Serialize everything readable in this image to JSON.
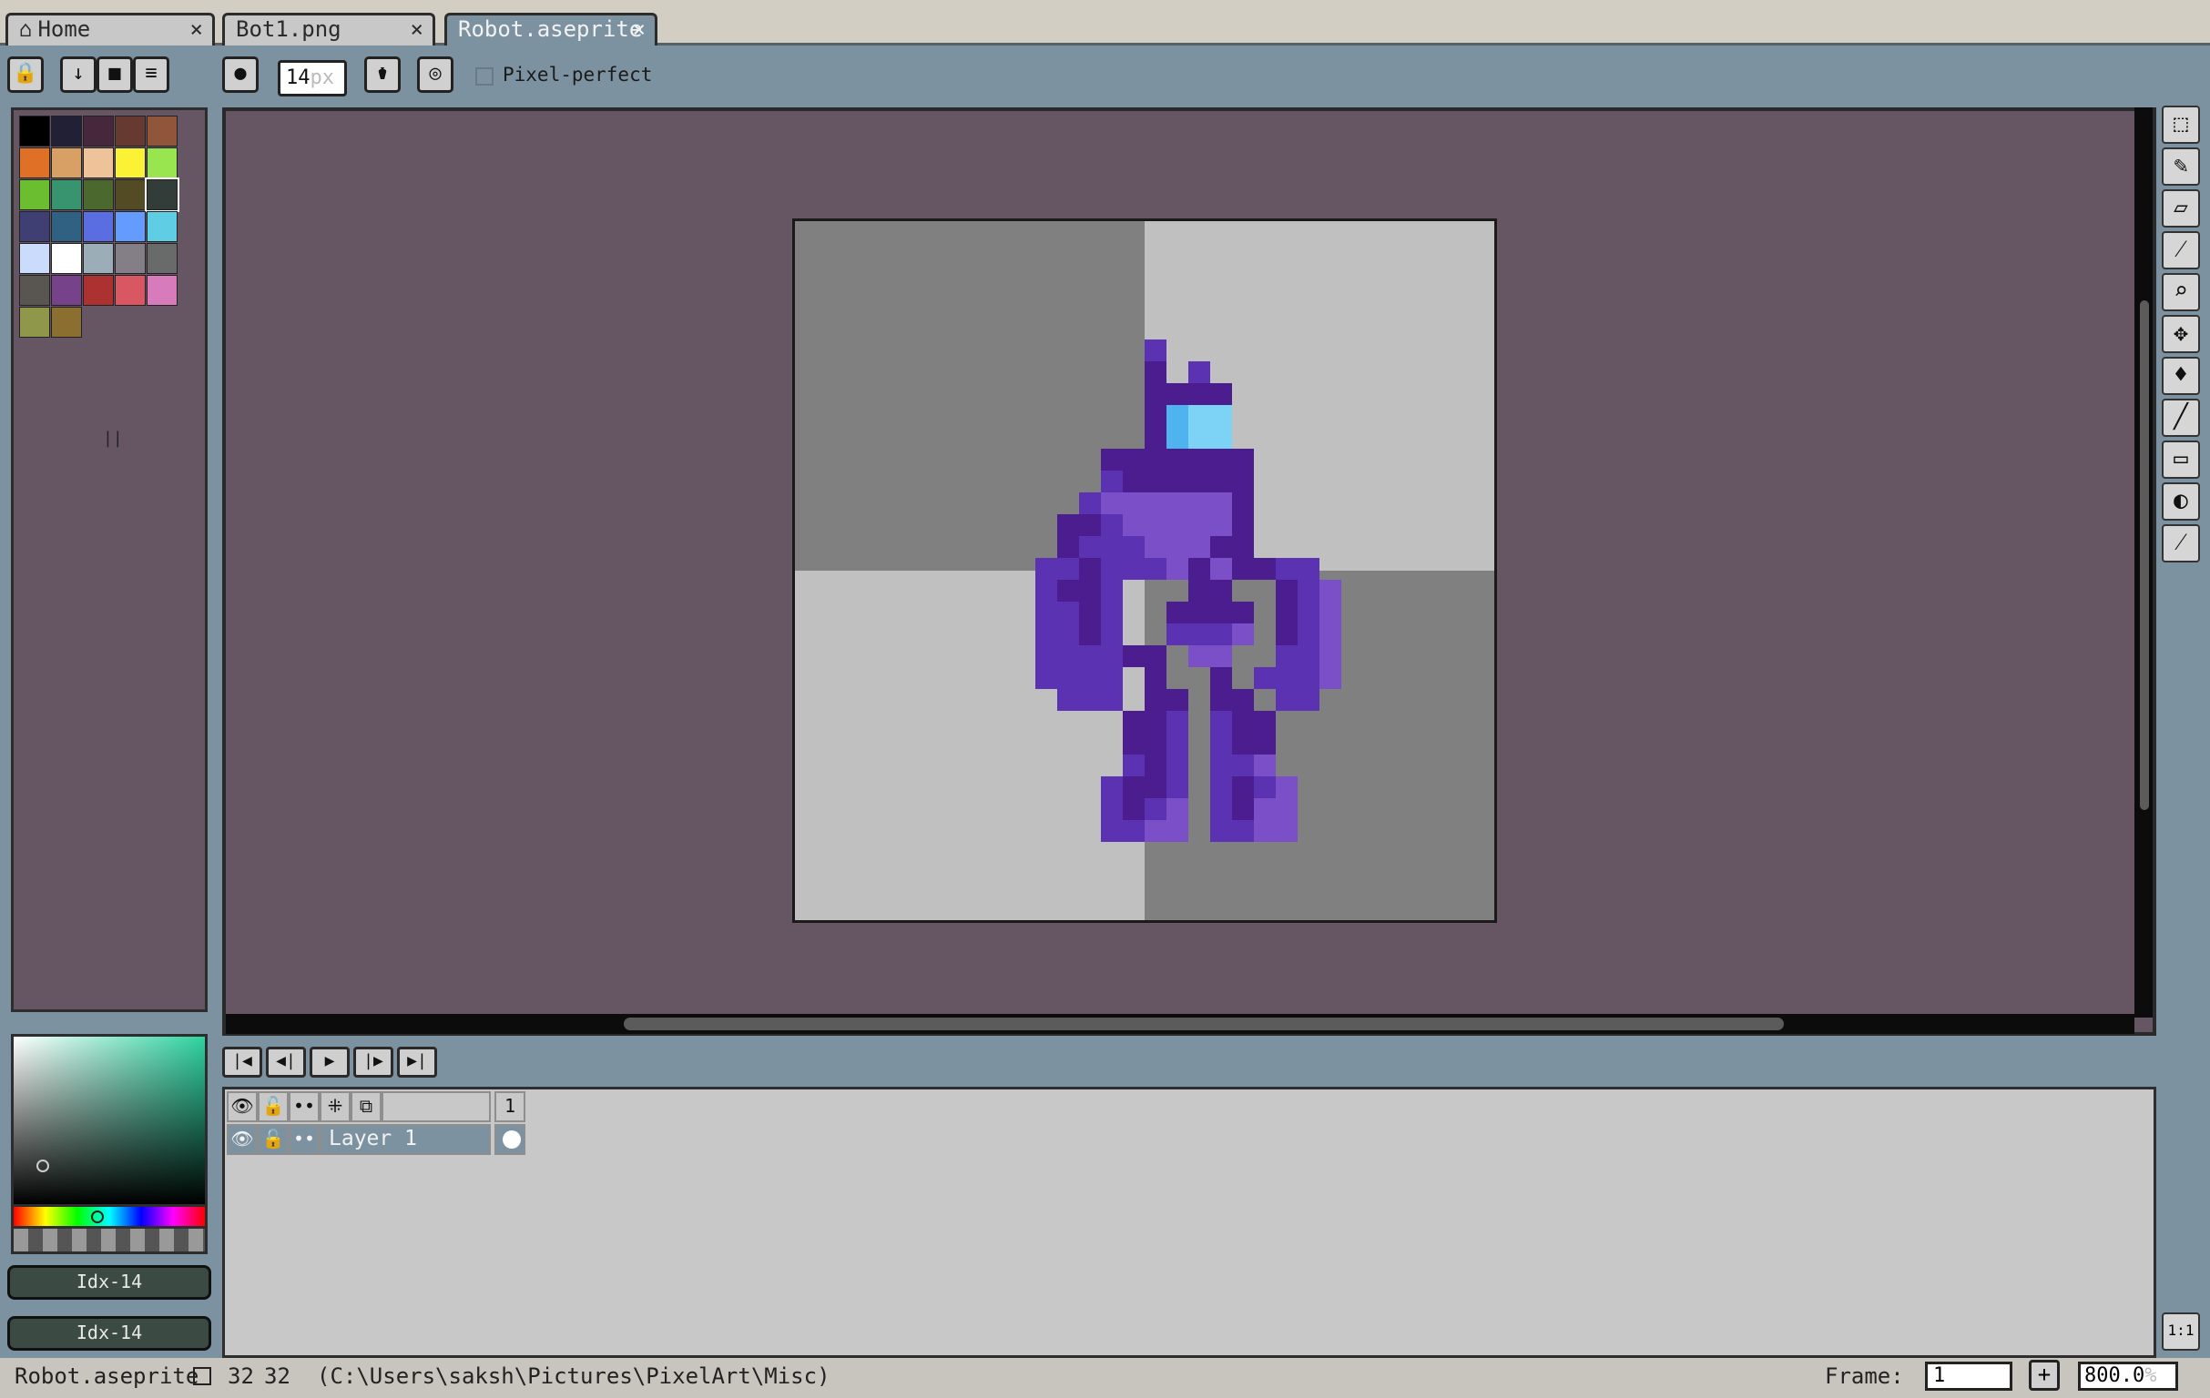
{
  "tabs": [
    {
      "label": "Home",
      "close": "×"
    },
    {
      "label": "Bot1.png",
      "close": "×"
    },
    {
      "label": "Robot.aseprite",
      "close": "×"
    }
  ],
  "toolbar": {
    "brush_size_value": "14",
    "brush_size_unit": "px",
    "pixel_perfect_label": "Pixel-perfect"
  },
  "palette": {
    "colors": [
      "#000000",
      "#222034",
      "#45283c",
      "#663931",
      "#8f563b",
      "#df7126",
      "#d9a066",
      "#eec39a",
      "#fbf236",
      "#99e550",
      "#6abe30",
      "#37946e",
      "#4b692f",
      "#524b24",
      "#323c39",
      "#3f3f74",
      "#306082",
      "#5b6ee1",
      "#639bff",
      "#5fcde4",
      "#cbdbfc",
      "#ffffff",
      "#9badb7",
      "#847e87",
      "#696a6a",
      "#595652",
      "#76428a",
      "#ac3232",
      "#d95763",
      "#d77bba",
      "#8f974a",
      "#8a6f30"
    ],
    "count_label": "||"
  },
  "color_selector": {
    "fg_label": "Idx-14",
    "bg_label": "Idx-14"
  },
  "sprite": {
    "checker_dark": "#808080",
    "checker_light": "#c0c0c0",
    "palette": {
      "1": "#4b1d8f",
      "2": "#5b32b2",
      "3": "#7a4fc8",
      "4": "#4fb3f0",
      "5": "#7dd3f5"
    },
    "rows": [
      "................",
      ".......2.......",
      ".......1.2......",
      ".......1111.....",
      ".......1455.....",
      ".......1455.....",
      ".....1111111....",
      ".....2111111....",
      "....23333331....",
      "...112333331....",
      "...122233311....",
      "..2212223131122.",
      "..2112...11..123",
      "..2212..1111.123",
      "..2212..2223.123",
      "..222211.33..223",
      "..2222.1..1.2223",
      "...222.11.11.22.",
      "......112.211...",
      "......112.211...",
      "......212.223...",
      ".....2112.2123..",
      ".....2123.2133..",
      ".....2233.2233.."
    ]
  },
  "timeline": {
    "frame_header": "1",
    "layer_name": "Layer 1"
  },
  "status": {
    "filename": "Robot.aseprite",
    "width": "32",
    "height": "32",
    "path": "(C:\\Users\\saksh\\Pictures\\PixelArt\\Misc)",
    "frame_label": "Frame:",
    "frame_value": "1",
    "frame_add": "+",
    "zoom_value": "800.0",
    "zoom_unit": "%",
    "ratio_label": "1:1"
  }
}
